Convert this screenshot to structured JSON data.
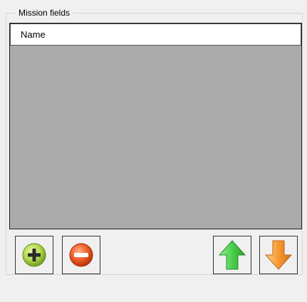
{
  "groupbox": {
    "title": "Mission fields"
  },
  "list": {
    "header_label": "Name"
  },
  "buttons": {
    "add_icon": "plus-circle-icon",
    "remove_icon": "minus-circle-icon",
    "up_icon": "arrow-up-icon",
    "down_icon": "arrow-down-icon"
  },
  "colors": {
    "background": "#f0f0f0",
    "list_background": "#ababab",
    "add_green": "#8cc63f",
    "remove_red": "#e8491d",
    "up_green": "#3fbf3f",
    "down_orange": "#f5922b"
  }
}
